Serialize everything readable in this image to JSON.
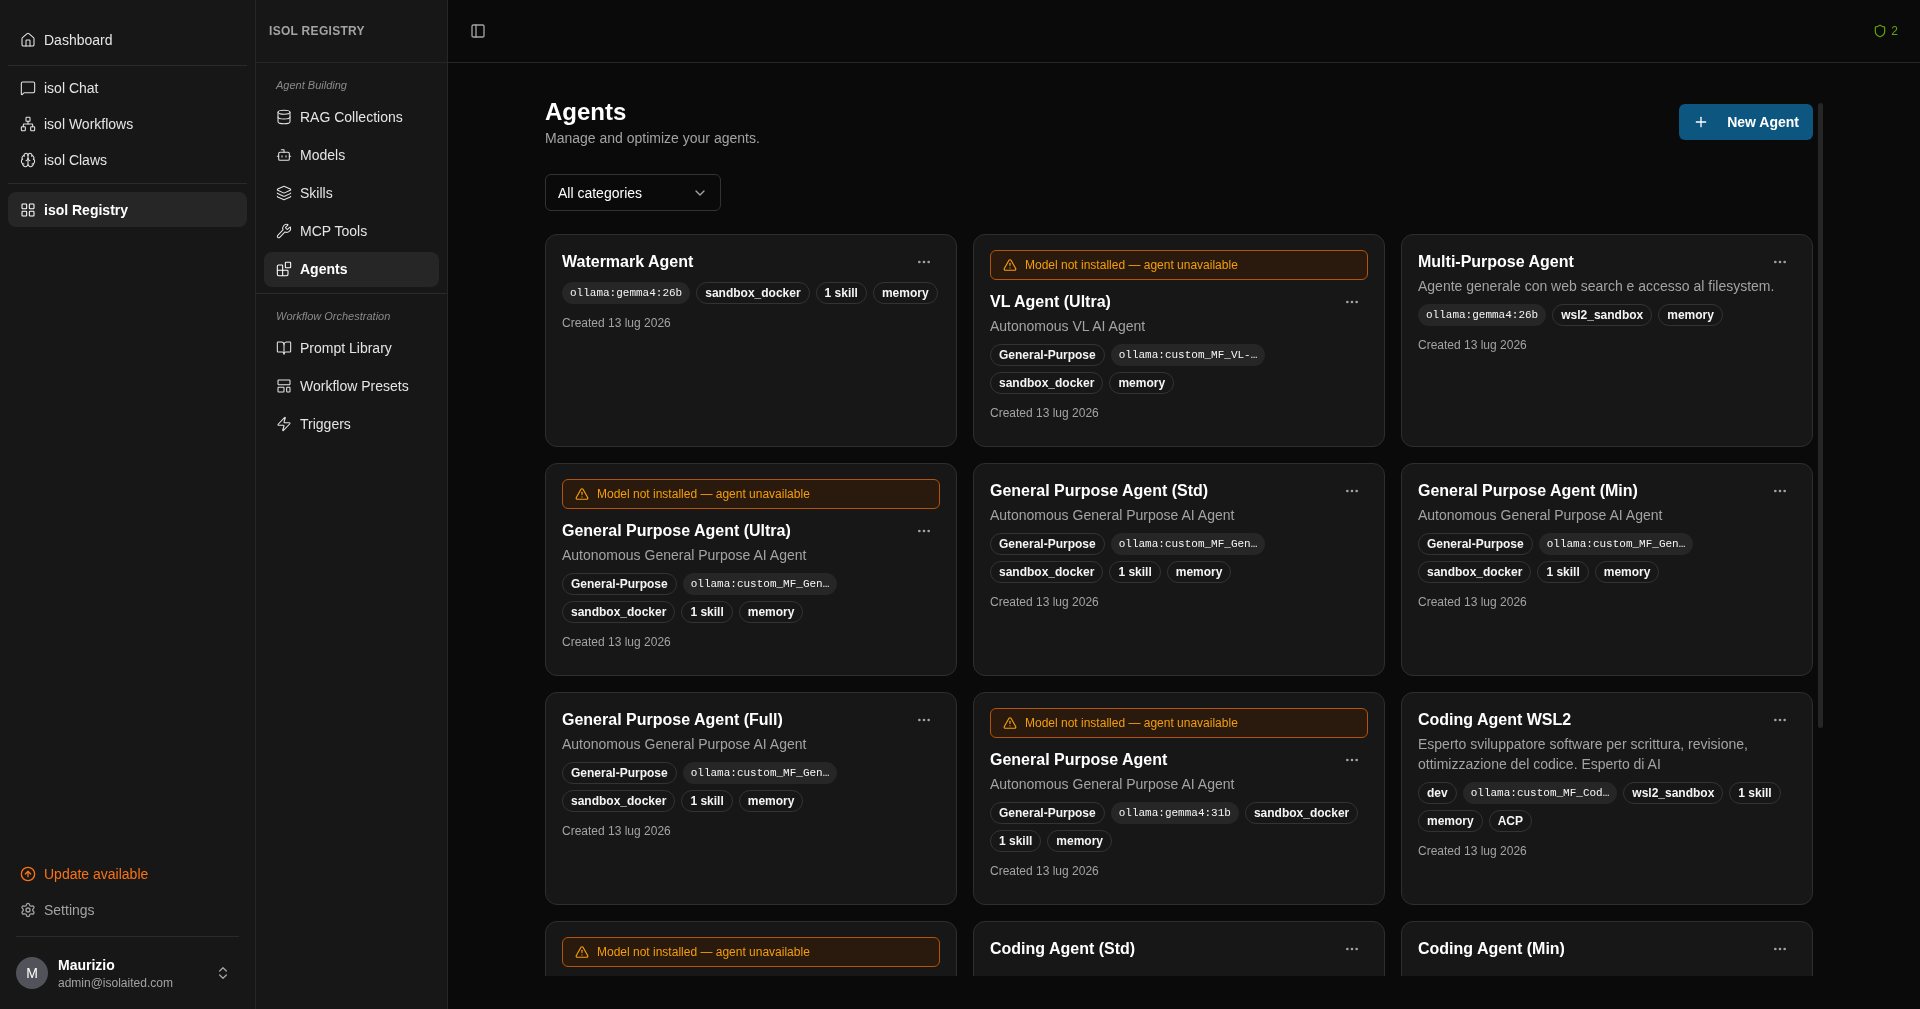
{
  "primary_nav": {
    "top": [
      {
        "label": "Dashboard",
        "selected": false
      }
    ],
    "apps": [
      {
        "label": "isol Chat",
        "selected": false
      },
      {
        "label": "isol Workflows",
        "selected": false
      },
      {
        "label": "isol Claws",
        "selected": false
      }
    ],
    "registry": [
      {
        "label": "isol Registry",
        "selected": true
      }
    ],
    "update": "Update available",
    "settings": "Settings",
    "user": {
      "initial": "M",
      "name": "Maurizio",
      "email": "admin@isolaited.com"
    }
  },
  "secondary_nav": {
    "title": "ISOL REGISTRY",
    "sections": [
      {
        "heading": "Agent Building",
        "items": [
          {
            "label": "RAG Collections",
            "selected": false
          },
          {
            "label": "Models",
            "selected": false
          },
          {
            "label": "Skills",
            "selected": false
          },
          {
            "label": "MCP Tools",
            "selected": false
          },
          {
            "label": "Agents",
            "selected": true
          }
        ]
      },
      {
        "heading": "Workflow Orchestration",
        "items": [
          {
            "label": "Prompt Library",
            "selected": false
          },
          {
            "label": "Workflow Presets",
            "selected": false
          },
          {
            "label": "Triggers",
            "selected": false
          }
        ]
      }
    ]
  },
  "header": {
    "badge_count": "2"
  },
  "page": {
    "title": "Agents",
    "subtitle": "Manage and optimize your agents.",
    "new_button": "New Agent",
    "filter": {
      "value": "All categories"
    }
  },
  "agents": [
    {
      "name": "Watermark Agent",
      "tags": [
        {
          "kind": "model",
          "text": "ollama:gemma4:26b"
        },
        {
          "kind": "tag",
          "text": "sandbox_docker"
        },
        {
          "kind": "tag",
          "text": "1 skill"
        },
        {
          "kind": "tag",
          "text": "memory"
        }
      ],
      "created": "Created 13 lug 2026"
    },
    {
      "warning": "Model not installed — agent unavailable",
      "name": "VL Agent (Ultra)",
      "description": "Autonomous VL AI Agent",
      "tags": [
        {
          "kind": "tag",
          "text": "General-Purpose"
        },
        {
          "kind": "model",
          "text": "ollama:custom_MF_VL-…"
        },
        {
          "kind": "tag",
          "text": "sandbox_docker"
        },
        {
          "kind": "tag",
          "text": "memory"
        }
      ],
      "created": "Created 13 lug 2026"
    },
    {
      "name": "Multi-Purpose Agent",
      "description": "Agente generale con web search e accesso al filesystem.",
      "tags": [
        {
          "kind": "model",
          "text": "ollama:gemma4:26b"
        },
        {
          "kind": "tag",
          "text": "wsl2_sandbox"
        },
        {
          "kind": "tag",
          "text": "memory"
        }
      ],
      "created": "Created 13 lug 2026"
    },
    {
      "warning": "Model not installed — agent unavailable",
      "name": "General Purpose Agent (Ultra)",
      "description": "Autonomous General Purpose AI Agent",
      "tags": [
        {
          "kind": "tag",
          "text": "General-Purpose"
        },
        {
          "kind": "model",
          "text": "ollama:custom_MF_Gen…"
        },
        {
          "kind": "tag",
          "text": "sandbox_docker"
        },
        {
          "kind": "tag",
          "text": "1 skill"
        },
        {
          "kind": "tag",
          "text": "memory"
        }
      ],
      "created": "Created 13 lug 2026"
    },
    {
      "name": "General Purpose Agent (Std)",
      "description": "Autonomous General Purpose AI Agent",
      "tags": [
        {
          "kind": "tag",
          "text": "General-Purpose"
        },
        {
          "kind": "model",
          "text": "ollama:custom_MF_Gen…"
        },
        {
          "kind": "tag",
          "text": "sandbox_docker"
        },
        {
          "kind": "tag",
          "text": "1 skill"
        },
        {
          "kind": "tag",
          "text": "memory"
        }
      ],
      "created": "Created 13 lug 2026"
    },
    {
      "name": "General Purpose Agent (Min)",
      "description": "Autonomous General Purpose AI Agent",
      "tags": [
        {
          "kind": "tag",
          "text": "General-Purpose"
        },
        {
          "kind": "model",
          "text": "ollama:custom_MF_Gen…"
        },
        {
          "kind": "tag",
          "text": "sandbox_docker"
        },
        {
          "kind": "tag",
          "text": "1 skill"
        },
        {
          "kind": "tag",
          "text": "memory"
        }
      ],
      "created": "Created 13 lug 2026"
    },
    {
      "name": "General Purpose Agent (Full)",
      "description": "Autonomous General Purpose AI Agent",
      "tags": [
        {
          "kind": "tag",
          "text": "General-Purpose"
        },
        {
          "kind": "model",
          "text": "ollama:custom_MF_Gen…"
        },
        {
          "kind": "tag",
          "text": "sandbox_docker"
        },
        {
          "kind": "tag",
          "text": "1 skill"
        },
        {
          "kind": "tag",
          "text": "memory"
        }
      ],
      "created": "Created 13 lug 2026"
    },
    {
      "warning": "Model not installed — agent unavailable",
      "name": "General Purpose Agent",
      "description": "Autonomous General Purpose AI Agent",
      "tags": [
        {
          "kind": "tag",
          "text": "General-Purpose"
        },
        {
          "kind": "model",
          "text": "ollama:gemma4:31b"
        },
        {
          "kind": "tag",
          "text": "sandbox_docker"
        },
        {
          "kind": "tag",
          "text": "1 skill"
        },
        {
          "kind": "tag",
          "text": "memory"
        }
      ],
      "created": "Created 13 lug 2026"
    },
    {
      "name": "Coding Agent WSL2",
      "description": "Esperto sviluppatore software per scrittura, revisione, ottimizzazione del codice. Esperto di AI",
      "tags": [
        {
          "kind": "tag",
          "text": "dev"
        },
        {
          "kind": "model",
          "text": "ollama:custom_MF_Cod…"
        },
        {
          "kind": "tag",
          "text": "wsl2_sandbox"
        },
        {
          "kind": "tag",
          "text": "1 skill"
        },
        {
          "kind": "tag",
          "text": "memory"
        },
        {
          "kind": "tag",
          "text": "ACP"
        }
      ],
      "created": "Created 13 lug 2026"
    },
    {
      "warning": "Model not installed — agent unavailable"
    },
    {
      "name": "Coding Agent (Std)"
    },
    {
      "name": "Coding Agent (Min)"
    }
  ]
}
